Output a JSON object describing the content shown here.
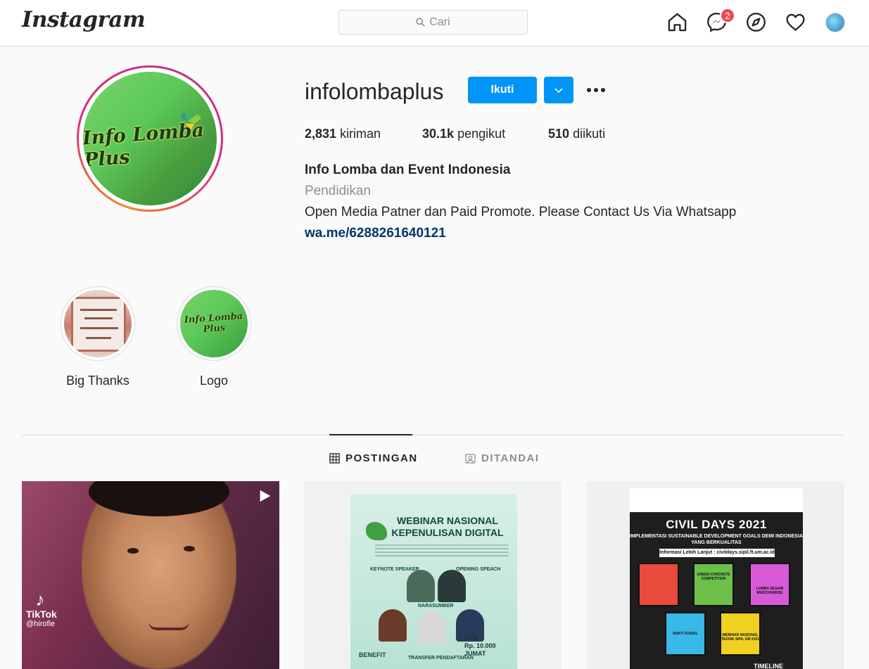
{
  "nav": {
    "logo": "Instagram",
    "search_placeholder": "Cari",
    "messenger_badge": "2",
    "icons": [
      "home-icon",
      "messenger-icon",
      "explore-icon",
      "heart-icon",
      "profile-avatar"
    ]
  },
  "profile": {
    "username": "infolombaplus",
    "follow_label": "Ikuti",
    "avatar_text": "Info Lomba Plus",
    "stats": {
      "posts_count": "2,831",
      "posts_label": "kiriman",
      "followers_count": "30.1k",
      "followers_label": "pengikut",
      "following_count": "510",
      "following_label": "diikuti"
    },
    "full_name": "Info Lomba dan Event Indonesia",
    "category": "Pendidikan",
    "bio": "Open Media Patner dan Paid Promote. Please Contact Us Via Whatsapp",
    "link": "wa.me/6288261640121"
  },
  "highlights": [
    {
      "label": "Big Thanks"
    },
    {
      "label": "Logo",
      "image_text": "Info Lomba Plus"
    }
  ],
  "tabs": {
    "posts": "POSTINGAN",
    "tagged": "DITANDAI"
  },
  "posts": [
    {
      "type": "video",
      "overlay_brand": "TikTok",
      "overlay_user": "@hirofie"
    },
    {
      "type": "image",
      "title_line1": "WEBINAR NASIONAL",
      "title_line2": "KEPENULISAN DIGITAL",
      "keynote": "KEYNOTE SPEAKER",
      "opening": "OPENING SPEACH",
      "narasumber": "NARASUMBER",
      "benefit": "BENEFIT",
      "transfer": "TRANSFER PENDAFTARAN",
      "htm": "HTM",
      "price": "Rp. 10.000",
      "day": "JUMAT"
    },
    {
      "type": "image",
      "title": "CIVIL DAYS 2021",
      "subtitle": "IMPLEMENTASI SUSTAINABLE DEVELOPMENT GOALS DEMI INDONESIA YANG BERKUALITAS",
      "info": "Informasi Lebih Lanjut : civildays.sipil.ft.um.ac.id",
      "box1": "GREEN CONCRETE COMPETITION",
      "box2": "LOMBA DESAIN MERCHANDISE",
      "box3": "BAKTI SOSIAL",
      "box4": "WEBINAR NASIONAL TEKNIK SIPIL UM 2021",
      "footer": "TIMELINE"
    }
  ],
  "colors": {
    "accent": "#0095f6",
    "badge": "#ed4956",
    "link": "#00376b",
    "muted": "#8e8e8e",
    "border": "#dbdbdb"
  }
}
